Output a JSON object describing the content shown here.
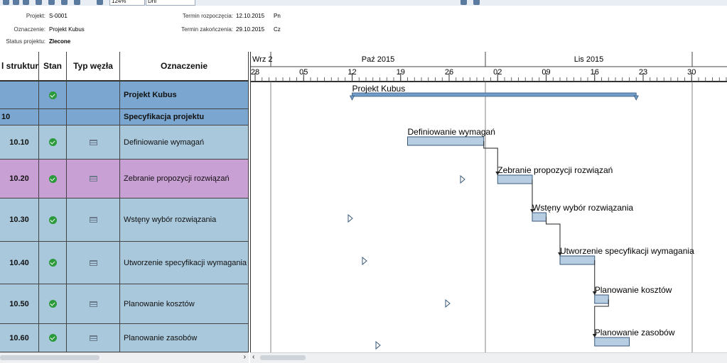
{
  "project_info": {
    "project_label": "Projekt:",
    "project_value": "S-0001",
    "name_label": "Oznaczenie:",
    "name_value": "Projekt Kubus",
    "status_label": "Status projektu:",
    "status_value": "Zlecone",
    "start_label": "Termin rozpoczęcia:",
    "start_value": "12.10.2015",
    "start_day": "Pn",
    "end_label": "Termin zakończenia:",
    "end_value": "29.10.2015",
    "end_day": "Cz"
  },
  "toolbar": {
    "zoom_value": "124%",
    "unit_value": "Dni"
  },
  "grid": {
    "headers": {
      "structure": "l struktur",
      "status": "Stan",
      "node_type": "Typ węzła",
      "name": "Oznaczenie"
    },
    "rows": [
      {
        "id": "",
        "name": "Projekt Kubus",
        "status": "check",
        "node_icon": "",
        "color": "#7aa6cf",
        "bold": true
      },
      {
        "id": "10",
        "name": "Specyfikacja projektu",
        "status": "",
        "node_icon": "",
        "color": "#7aa6cf",
        "bold": true
      },
      {
        "id": "10.10",
        "name": "Definiowanie wymagań",
        "status": "check",
        "node_icon": "table-icon",
        "color": "#a9c8dc",
        "bold": false
      },
      {
        "id": "10.20",
        "name": "Zebranie propozycji rozwiązań",
        "status": "check",
        "node_icon": "table-icon",
        "color": "#c9a0d4",
        "bold": false
      },
      {
        "id": "10.30",
        "name": "Wstęny wybór rozwiązania",
        "status": "check",
        "node_icon": "table-icon",
        "color": "#a9c8dc",
        "bold": false
      },
      {
        "id": "10.40",
        "name": "Utworzenie specyfikacji wymagania",
        "status": "check",
        "node_icon": "table-icon",
        "color": "#a9c8dc",
        "bold": false
      },
      {
        "id": "10.50",
        "name": "Planowanie kosztów",
        "status": "check",
        "node_icon": "table-icon",
        "color": "#a9c8dc",
        "bold": false
      },
      {
        "id": "10.60",
        "name": "Planowanie zasobów",
        "status": "check",
        "node_icon": "table-icon",
        "color": "#a9c8dc",
        "bold": false
      }
    ]
  },
  "gantt": {
    "months": [
      "Wrz 2",
      "Paź 2015",
      "Lis 2015"
    ],
    "days": [
      "28",
      "05",
      "12",
      "19",
      "26",
      "02",
      "09",
      "16",
      "23",
      "30"
    ],
    "start_date": "2015-09-28",
    "tasks": [
      {
        "label": "Projekt Kubus",
        "start": "2015-10-12",
        "end": "2015-11-22",
        "type": "summary"
      },
      {
        "label": "Definiowanie wymagań",
        "start": "2015-10-20",
        "end": "2015-10-31"
      },
      {
        "label": "Zebranie propozycji rozwiązań",
        "start": "2015-11-02",
        "end": "2015-11-07"
      },
      {
        "label": "Wstęny wybór rozwiązania",
        "start": "2015-11-07",
        "end": "2015-11-09"
      },
      {
        "label": "Utworzenie specyfikacji wymagania",
        "start": "2015-11-11",
        "end": "2015-11-16"
      },
      {
        "label": "Planowanie kosztów",
        "start": "2015-11-16",
        "end": "2015-11-18"
      },
      {
        "label": "Planowanie zasobów",
        "start": "2015-11-16",
        "end": "2015-11-21"
      }
    ]
  },
  "colors": {
    "bar": "#b6cde2",
    "bar_border": "#3a5a7a",
    "summary": "#6f9cc8"
  }
}
